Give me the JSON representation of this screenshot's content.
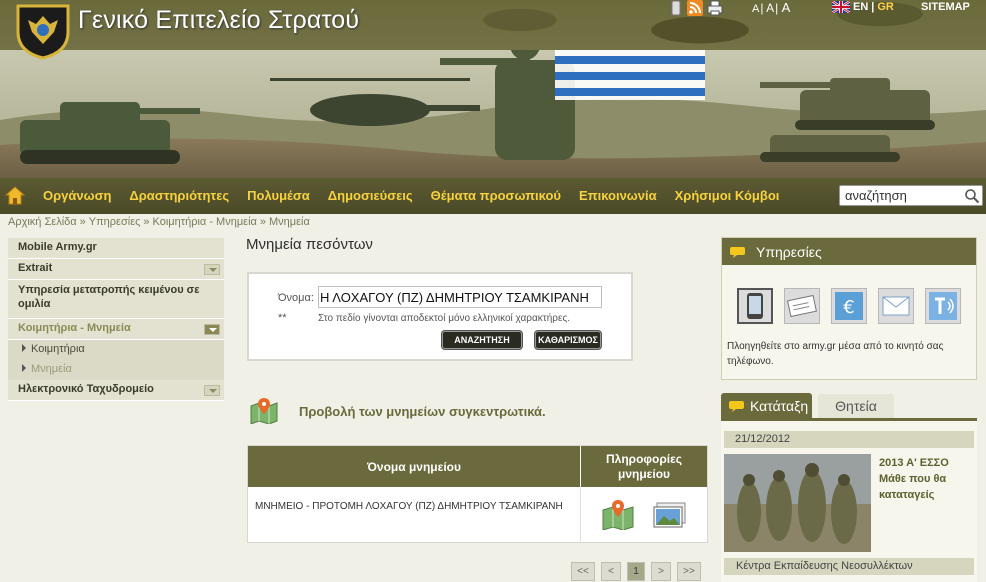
{
  "header": {
    "title": "Γενικό Επιτελείο Στρατού",
    "font_sizes": [
      "A",
      "A",
      "A"
    ],
    "lang_en": "EN",
    "lang_sep": "|",
    "lang_gr": "GR",
    "sitemap": "SITEMAP"
  },
  "nav": {
    "items": [
      "Οργάνωση",
      "Δραστηριότητες",
      "Πολυμέσα",
      "Δημοσιεύσεις",
      "Θέματα προσωπικού",
      "Επικοινωνία",
      "Χρήσιμοι Κόμβοι"
    ],
    "search_value": "αναζήτηση"
  },
  "breadcrumb": [
    "Αρχική Σελίδα",
    "Υπηρεσίες",
    "Κοιμητήρια - Μνημεία",
    "Μνημεία"
  ],
  "breadcrumb_sep": "»",
  "left_menu": {
    "items": [
      {
        "label": "Mobile Army.gr"
      },
      {
        "label": "Extrait"
      },
      {
        "label": "Υπηρεσία μετατροπής κειμένου σε ομιλία"
      },
      {
        "label": "Κοιμητήρια - Μνημεία"
      },
      {
        "label": "Ηλεκτρονικό Ταχυδρομείο"
      }
    ],
    "subitems": [
      "Κοιμητήρια",
      "Μνημεία"
    ]
  },
  "main": {
    "page_title": "Μνημεία πεσόντων",
    "name_label": "Όνομα:",
    "name_value": "Η ΛΟΧΑΓΟΥ (ΠΖ) ΔΗΜΗΤΡΙΟΥ ΤΣΑΜΚΙΡΑΝΗ",
    "stars": "**",
    "hint": "Στο πεδίο γίνονται αποδεκτοί μόνο ελληνικοί χαρακτήρες.",
    "search_button": "ΑΝΑΖΗΤΗΣΗ",
    "clear_button": "ΚΑΘΑΡΙΣΜΟΣ",
    "map_link": "Προβολή των μνημείων συγκεντρωτικά.",
    "table": {
      "col_name": "Όνομα μνημείου",
      "col_info": "Πληροφορίες μνημείου",
      "rows": [
        {
          "name": "ΜΝΗΜΕΙΟ - ΠΡΟΤΟΜΗ ΛΟΧΑΓΟΥ (ΠΖ) ΔΗΜΗΤΡΙΟΥ ΤΣΑΜΚΙΡΑΝΗ"
        }
      ]
    },
    "pager": [
      "<<",
      "<",
      "1",
      ">",
      ">>"
    ]
  },
  "right": {
    "services_title": "Υπηρεσίες",
    "services_text": "Πλοηγηθείτε στο army.gr μέσα από το κινητό σας τηλέφωνο.",
    "tab_active": "Κατάταξη",
    "tab_other": "Θητεία",
    "news_date": "21/12/2012",
    "news_title_1": "2013 Α' ΕΣΣΟ",
    "news_title_2": "Μάθε που θα",
    "news_title_3": "καταταγείς",
    "news_footer": "Κέντρα Εκπαίδευσης Νεοσυλλέκτων"
  },
  "colors": {
    "olive_dark": "#6a6a3c",
    "nav_text": "#f7d23e",
    "page_bg": "#f1f0e6"
  }
}
